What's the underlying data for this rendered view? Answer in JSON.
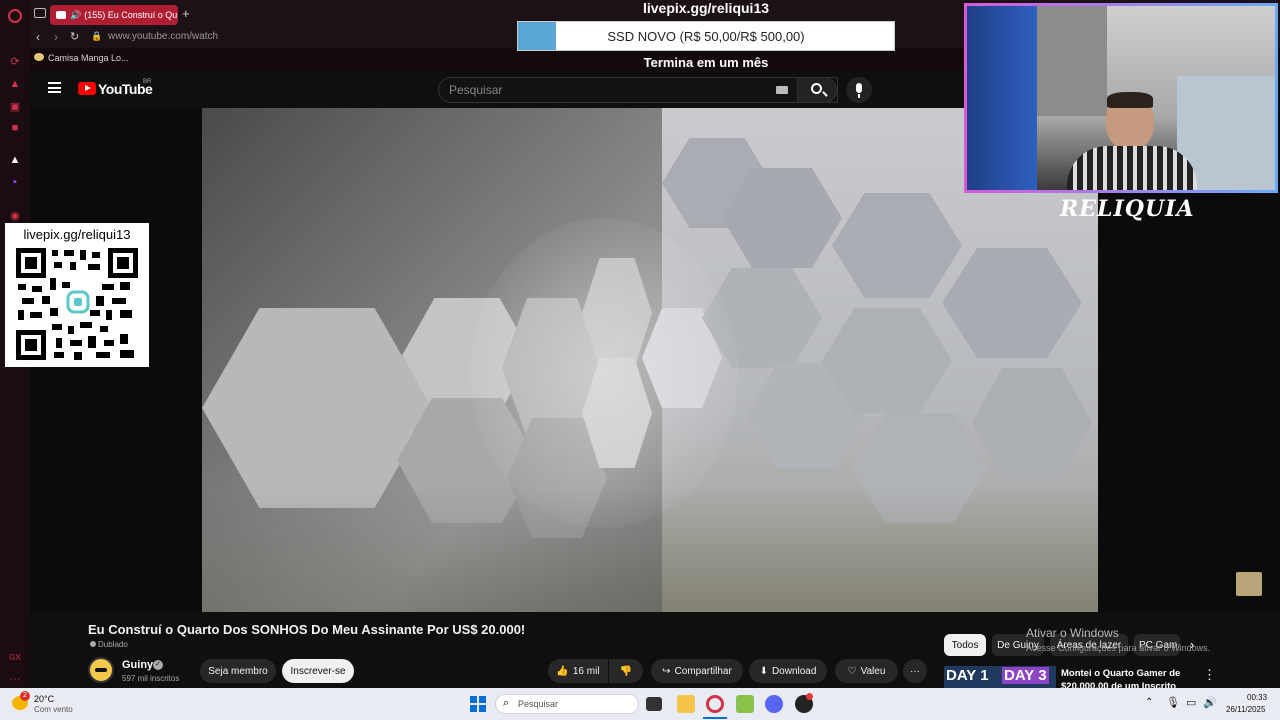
{
  "browser": {
    "tab_title": "(155) Eu Construí o Qu",
    "address": "www.youtube.com/watch",
    "bookmark": "Camisa Manga Lo..."
  },
  "youtube": {
    "logo": "YouTube",
    "region": "BR",
    "search_placeholder": "Pesquisar"
  },
  "overlay": {
    "donation_title": "livepix.gg/reliqui13",
    "donation_goal": "SSD NOVO (R$ 50,00/R$ 500,00)",
    "donation_progress": 0.1,
    "donation_deadline": "Termina em um mês",
    "qr_title": "livepix.gg/reliqui13",
    "streamer_name": "RELIQUIA"
  },
  "video": {
    "title": "Eu Construí o Quarto Dos SONHOS Do Meu Assinante Por US$ 20.000!",
    "dubbed_badge": "Dublado",
    "channel_name": "Guiny",
    "subscribers": "597 mil inscritos",
    "join_label": "Seja membro",
    "subscribe_label": "Inscrever-se",
    "likes": "16 mil",
    "share_label": "Compartilhar",
    "download_label": "Download",
    "thanks_label": "Valeu",
    "more_label": "···"
  },
  "recommendations": {
    "chips": [
      "Todos",
      "De Guiny",
      "Áreas de lazer",
      "PC Gam"
    ],
    "first_title_line1": "Montei o Quarto Gamer de",
    "first_title_line2": "$20.000,00 de um Inscrito",
    "thumb_text_1": "DAY 1",
    "thumb_text_2": "DAY 3"
  },
  "windows": {
    "activate_title": "Ativar o Windows",
    "activate_sub": "Acesse Configurações para ativar o Windows.",
    "weather_temp": "20°C",
    "weather_desc": "Com vento",
    "search_placeholder": "Pesquisar",
    "time": "00:33",
    "date": "26/11/2025",
    "weather_badge": "2"
  },
  "colors": {
    "opera_red": "#d2324a",
    "tab_active": "#b01e33",
    "progress_fill": "#5aa6d6",
    "webcam_border_start": "#d85ad8",
    "webcam_border_end": "#6aa8ff"
  }
}
